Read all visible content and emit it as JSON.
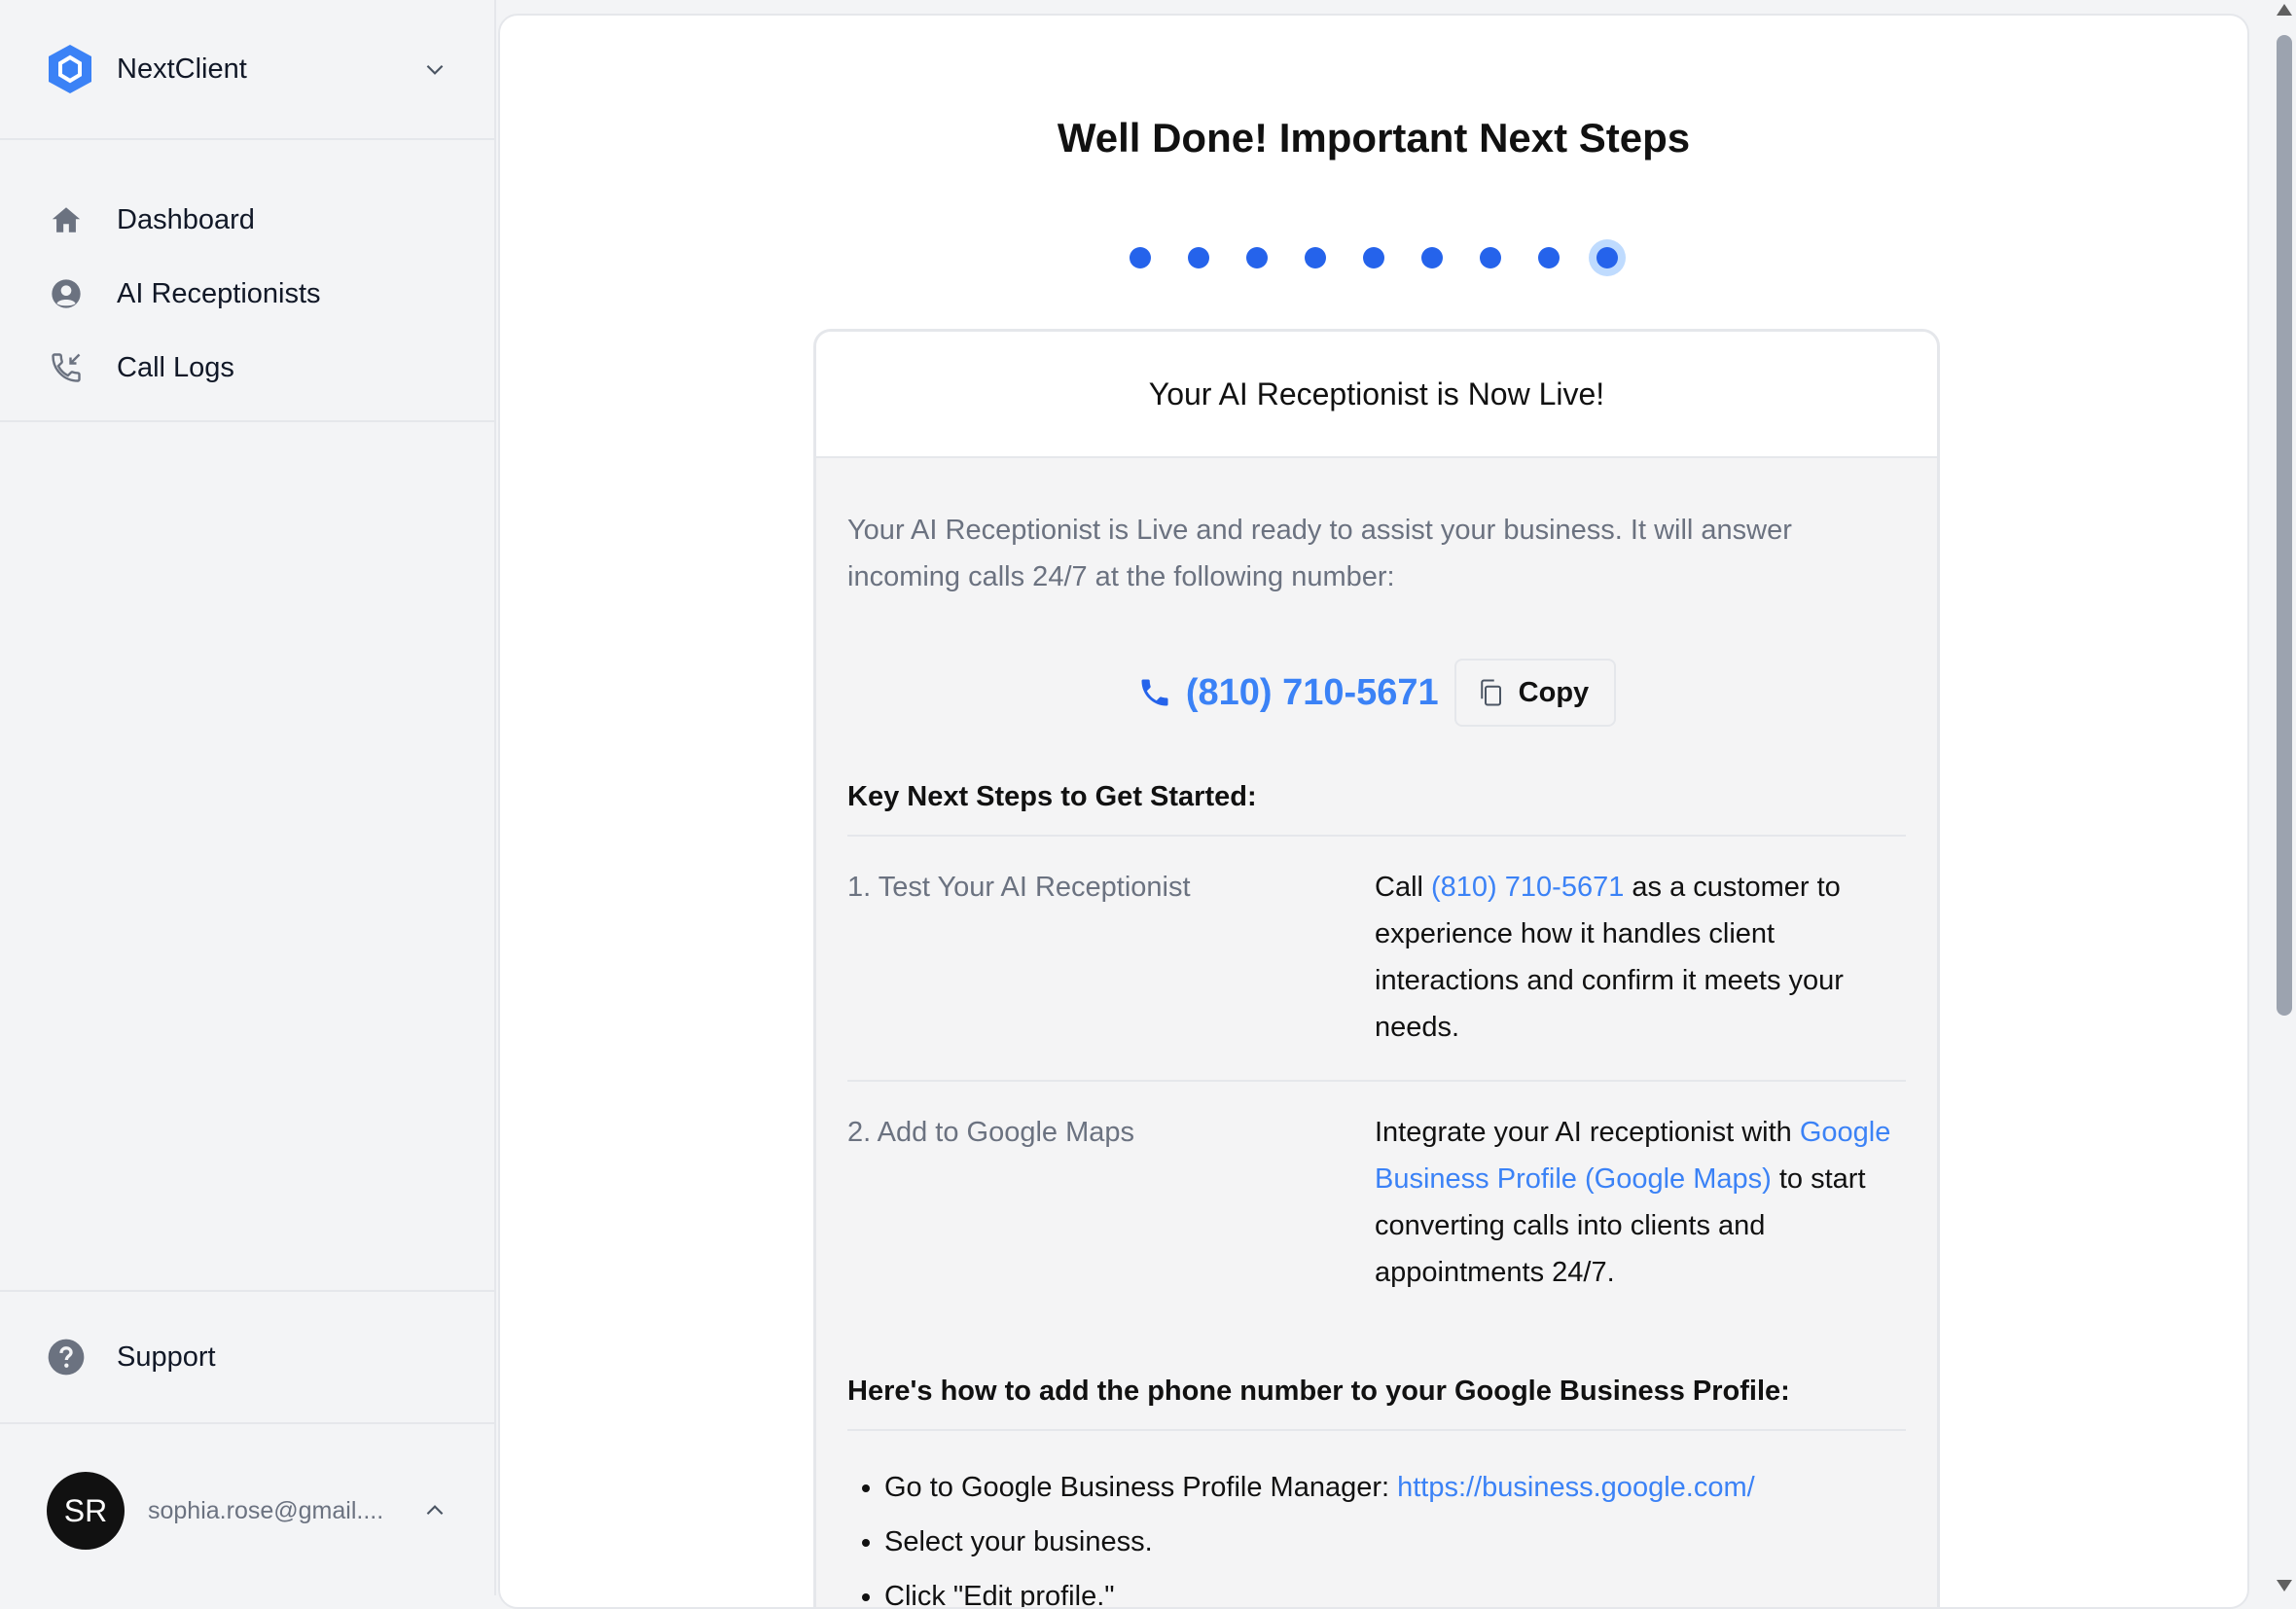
{
  "app": {
    "name": "NextClient"
  },
  "nav": {
    "items": [
      {
        "label": "Dashboard",
        "icon": "home-icon"
      },
      {
        "label": "AI Receptionists",
        "icon": "user-circle-icon"
      },
      {
        "label": "Call Logs",
        "icon": "phone-incoming-icon"
      }
    ],
    "support_label": "Support"
  },
  "user": {
    "initials": "SR",
    "email": "sophia.rose@gmail...."
  },
  "page": {
    "title": "Well Done! Important Next Steps",
    "steps_total": 9,
    "steps_current": 9
  },
  "card": {
    "header": "Your AI Receptionist is Now Live!",
    "intro": "Your AI Receptionist is Live and ready to assist your business. It will answer incoming calls 24/7 at the following number:",
    "phone": "(810) 710-5671",
    "copy_label": "Copy",
    "key_steps_title": "Key Next Steps to Get Started:",
    "step1": {
      "title": "1. Test Your AI Receptionist",
      "pre": "Call ",
      "link": "(810) 710-5671",
      "post": " as a customer to experience how it handles client interactions and confirm it meets your needs."
    },
    "step2": {
      "title": "2. Add to Google Maps",
      "pre": "Integrate your AI receptionist with ",
      "link": "Google Business Profile (Google Maps)",
      "post": " to start converting calls into clients and appointments 24/7."
    },
    "howto_title": "Here's how to add the phone number to your Google Business Profile:",
    "bullet1_pre": "Go to Google Business Profile Manager: ",
    "bullet1_link": "https://business.google.com/",
    "bullet2": "Select your business.",
    "bullet3": "Click \"Edit profile.\""
  },
  "colors": {
    "accent": "#2563eb",
    "link": "#3b82f6",
    "active_ring": "#bfdbfe"
  }
}
